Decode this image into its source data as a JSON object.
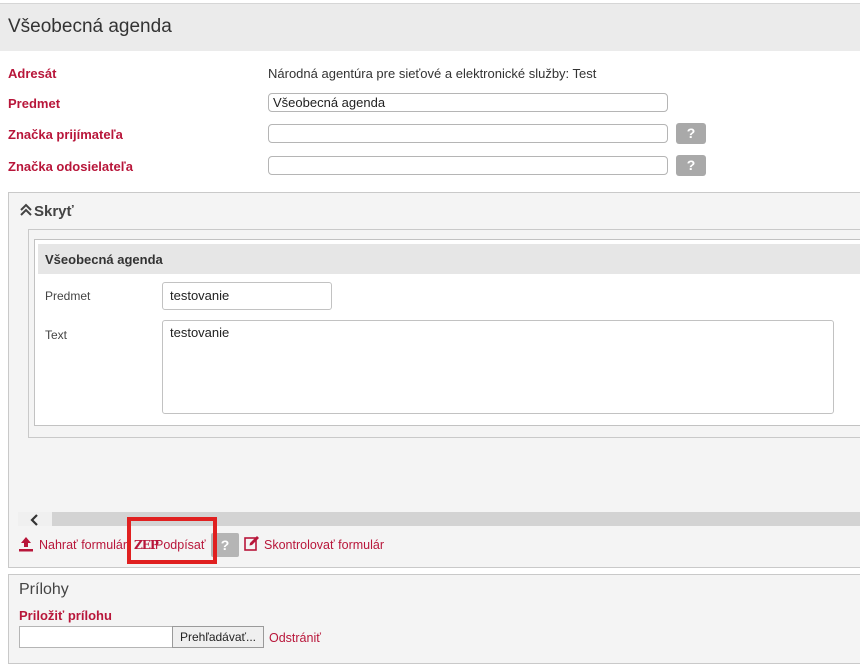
{
  "header": {
    "title": "Všeobecná agenda"
  },
  "form": {
    "adresat_label": "Adresát",
    "adresat_value": "Národná agentúra pre sieťové a elektronické služby: Test",
    "predmet_label": "Predmet",
    "predmet_value": "Všeobecná agenda",
    "znacka_prijimatela_label": "Značka prijímateľa",
    "znacka_prijimatela_value": "",
    "znacka_odosielatela_label": "Značka odosielateľa",
    "znacka_odosielatela_value": "",
    "help_label": "?"
  },
  "panel": {
    "toggle_label": "Skryť",
    "inner_title": "Všeobecná agenda",
    "predmet_label": "Predmet",
    "predmet_value": "testovanie",
    "text_label": "Text",
    "text_value": "testovanie",
    "scroll_left": "‹"
  },
  "actions": {
    "upload_label": "Nahrať formulár",
    "zep_badge": "ZEP",
    "sign_label": "Podpísať",
    "help_label": "?",
    "check_label": "Skontrolovať formulár"
  },
  "attachments": {
    "title": "Prílohy",
    "attach_label": "Priložiť prílohu",
    "browse_label": "Prehľadávať...",
    "remove_label": "Odstrániť"
  },
  "colors": {
    "accent": "#b8163a",
    "highlight": "#e02020"
  }
}
